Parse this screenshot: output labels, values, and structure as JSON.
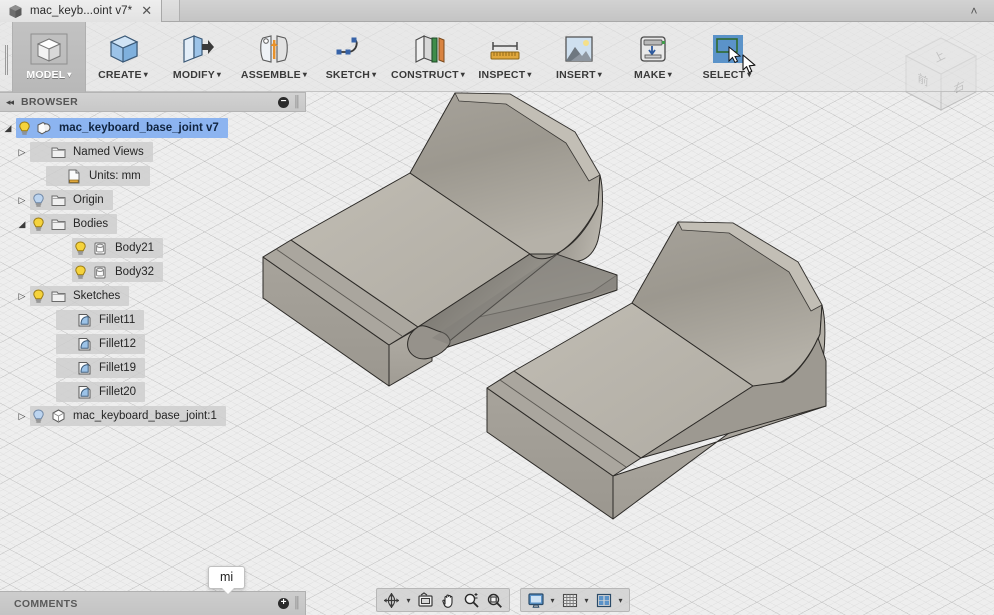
{
  "window": {
    "tab_title": "mac_keyb...oint v7*",
    "tab_close_label": "✕",
    "collapse_label": "˄",
    "app_icon": "cube-icon"
  },
  "ribbon": {
    "buttons": [
      {
        "label": "MODEL",
        "icon": "model-cube-icon",
        "caret": "▾",
        "active": true
      },
      {
        "label": "CREATE",
        "icon": "create-box-icon",
        "caret": "▾",
        "active": false
      },
      {
        "label": "MODIFY",
        "icon": "modify-push-icon",
        "caret": "▾",
        "active": false
      },
      {
        "label": "ASSEMBLE",
        "icon": "assemble-joint-icon",
        "caret": "▾",
        "active": false
      },
      {
        "label": "SKETCH",
        "icon": "sketch-spline-icon",
        "caret": "▾",
        "active": false
      },
      {
        "label": "CONSTRUCT",
        "icon": "construct-plane-icon",
        "caret": "▾",
        "active": false
      },
      {
        "label": "INSPECT",
        "icon": "inspect-ruler-icon",
        "caret": "▾",
        "active": false
      },
      {
        "label": "INSERT",
        "icon": "insert-image-icon",
        "caret": "▾",
        "active": false
      },
      {
        "label": "MAKE",
        "icon": "make-printer-icon",
        "caret": "▾",
        "active": false
      },
      {
        "label": "SELECT",
        "icon": "select-window-icon",
        "caret": "▾",
        "active": false
      }
    ]
  },
  "browser": {
    "title": "BROWSER",
    "collapse_arrows": "◂◂",
    "minimize_label": "−",
    "tree": [
      {
        "label": "mac_keyboard_base_joint v7",
        "twisty": "expanded",
        "bulb": "on",
        "icon": "component-icon",
        "indent": 10,
        "selected": true
      },
      {
        "label": "Named Views",
        "twisty": "collapsed",
        "bulb": "none",
        "icon": "folder-icon",
        "indent": 30,
        "selected": false
      },
      {
        "label": "Units: mm",
        "twisty": "none",
        "bulb": "none",
        "icon": "document-icon",
        "indent": 46,
        "selected": false
      },
      {
        "label": "Origin",
        "twisty": "collapsed",
        "bulb": "off",
        "icon": "folder-icon",
        "indent": 30,
        "selected": false
      },
      {
        "label": "Bodies",
        "twisty": "expanded",
        "bulb": "on",
        "icon": "folder-icon",
        "indent": 30,
        "selected": false
      },
      {
        "label": "Body21",
        "twisty": "none",
        "bulb": "on",
        "icon": "body-icon",
        "indent": 72,
        "selected": false
      },
      {
        "label": "Body32",
        "twisty": "none",
        "bulb": "on",
        "icon": "body-icon",
        "indent": 72,
        "selected": false
      },
      {
        "label": "Sketches",
        "twisty": "collapsed",
        "bulb": "on",
        "icon": "folder-icon",
        "indent": 30,
        "selected": false
      },
      {
        "label": "Fillet11",
        "twisty": "none",
        "bulb": "none",
        "icon": "fillet-icon",
        "indent": 56,
        "selected": false
      },
      {
        "label": "Fillet12",
        "twisty": "none",
        "bulb": "none",
        "icon": "fillet-icon",
        "indent": 56,
        "selected": false
      },
      {
        "label": "Fillet19",
        "twisty": "none",
        "bulb": "none",
        "icon": "fillet-icon",
        "indent": 56,
        "selected": false
      },
      {
        "label": "Fillet20",
        "twisty": "none",
        "bulb": "none",
        "icon": "fillet-icon",
        "indent": 56,
        "selected": false
      },
      {
        "label": "mac_keyboard_base_joint:1",
        "twisty": "collapsed",
        "bulb": "off",
        "icon": "occurrence-icon",
        "indent": 30,
        "selected": false
      }
    ]
  },
  "viewcube": {
    "face_top": "上",
    "face_front": "前",
    "face_right": "右"
  },
  "comments": {
    "title": "COMMENTS",
    "add_label": "+"
  },
  "tooltip": {
    "text": "mi"
  },
  "navbar": {
    "groups": [
      {
        "items": [
          {
            "icon": "orbit-icon",
            "caret": true
          },
          {
            "icon": "look-at-icon",
            "caret": false
          },
          {
            "icon": "pan-hand-icon",
            "caret": false
          },
          {
            "icon": "zoom-icon",
            "caret": false
          },
          {
            "icon": "fit-icon",
            "caret": false
          }
        ]
      },
      {
        "items": [
          {
            "icon": "display-settings-icon",
            "caret": true
          },
          {
            "icon": "grid-snap-icon",
            "caret": true
          },
          {
            "icon": "viewport-layout-icon",
            "caret": true
          }
        ]
      }
    ]
  },
  "colors": {
    "accent_selection": "#8cb4f0",
    "canvas_bg": "#eeeeee",
    "model_fill": "#b4b0a8",
    "model_shade": "#8f8c85",
    "ribbon_bg": "#e4e4e4"
  }
}
